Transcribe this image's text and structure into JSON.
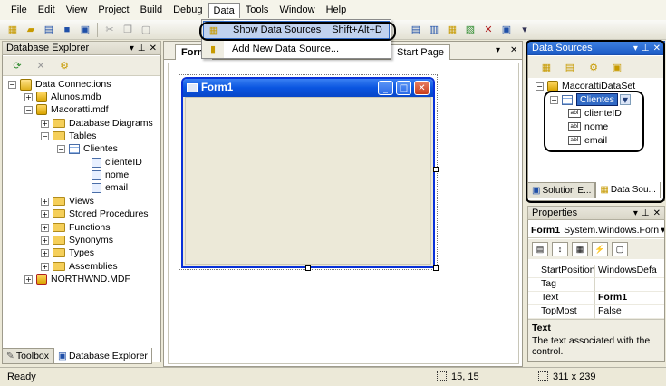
{
  "menu": [
    "File",
    "Edit",
    "View",
    "Project",
    "Build",
    "Debug",
    "Data",
    "Tools",
    "Window",
    "Help"
  ],
  "data_menu": {
    "items": [
      {
        "label": "Show Data Sources",
        "shortcut": "Shift+Alt+D"
      },
      {
        "label": "Add New Data Source...",
        "shortcut": ""
      }
    ]
  },
  "database_explorer": {
    "title": "Database Explorer",
    "tree": {
      "root": "Data Connections",
      "alunos": "Alunos.mdb",
      "macoratti": "Macoratti.mdf",
      "diagrams": "Database Diagrams",
      "tables": "Tables",
      "clientes": "Clientes",
      "col1": "clienteID",
      "col2": "nome",
      "col3": "email",
      "views": "Views",
      "procs": "Stored Procedures",
      "functions": "Functions",
      "synonyms": "Synonyms",
      "types": "Types",
      "assemblies": "Assemblies",
      "northwnd": "NORTHWND.MDF"
    },
    "tabs": [
      "Toolbox",
      "Database Explorer"
    ]
  },
  "document": {
    "tabs": [
      "Form",
      "Start Page"
    ],
    "form_title": "Form1"
  },
  "data_sources": {
    "title": "Data Sources",
    "dataset": "MacorattiDataSet",
    "table": "Clientes",
    "columns": [
      "clienteID",
      "nome",
      "email"
    ],
    "tabs": [
      "Solution E...",
      "Data Sou..."
    ]
  },
  "properties": {
    "title": "Properties",
    "object": "Form1",
    "object_type": "System.Windows.Forn",
    "rows": [
      {
        "name": "StartPosition",
        "value": "WindowsDefa"
      },
      {
        "name": "Tag",
        "value": ""
      },
      {
        "name": "Text",
        "value": "Form1"
      },
      {
        "name": "TopMost",
        "value": "False"
      }
    ],
    "desc_title": "Text",
    "desc_text": "The text associated with the control."
  },
  "status": {
    "ready": "Ready",
    "position": "15, 15",
    "size": "311 x 239"
  },
  "colors": {
    "accent": "#316ac5",
    "titlebar_active": "#1c5bc6",
    "callout": "#000000"
  }
}
